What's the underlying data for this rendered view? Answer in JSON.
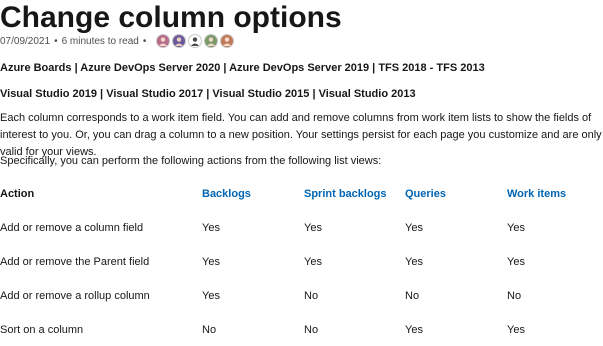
{
  "title": "Change column options",
  "meta": {
    "date": "07/09/2021",
    "bullet": "•",
    "read_time": "6 minutes to read",
    "contributors": [
      {
        "icon": "contributor-avatar-1",
        "color": "#b86a8a"
      },
      {
        "icon": "contributor-avatar-2",
        "color": "#6a5a9a"
      },
      {
        "icon": "contributor-avatar-3",
        "color": "#4a4a4a"
      },
      {
        "icon": "contributor-avatar-4",
        "color": "#7a9a6a"
      },
      {
        "icon": "contributor-avatar-5",
        "color": "#c07a5a"
      }
    ]
  },
  "applies_to_1": "Azure Boards | Azure DevOps Server 2020 | Azure DevOps Server 2019 | TFS 2018 - TFS 2013",
  "applies_to_2": "Visual Studio 2019 | Visual Studio 2017 | Visual Studio 2015 | Visual Studio 2013",
  "intro": "Each column corresponds to a work item field. You can add and remove columns from work item lists to show the fields of interest to you. Or, you can drag a column to a new position. Your settings persist for each page you customize and are only valid for your views.",
  "specifically": "Specifically, you can perform the following actions from the following list views:",
  "table": {
    "headers": [
      "Action",
      "Backlogs",
      "Sprint backlogs",
      "Queries",
      "Work items"
    ],
    "rows": [
      [
        "Add or remove a column field",
        "Yes",
        "Yes",
        "Yes",
        "Yes"
      ],
      [
        "Add or remove the Parent field",
        "Yes",
        "Yes",
        "Yes",
        "Yes"
      ],
      [
        "Add or remove a rollup column",
        "Yes",
        "No",
        "No",
        "No"
      ],
      [
        "Sort on a column",
        "No",
        "No",
        "Yes",
        "Yes"
      ]
    ]
  },
  "colors": {
    "link": "#0065b3",
    "text": "#171717",
    "meta": "#505050"
  }
}
